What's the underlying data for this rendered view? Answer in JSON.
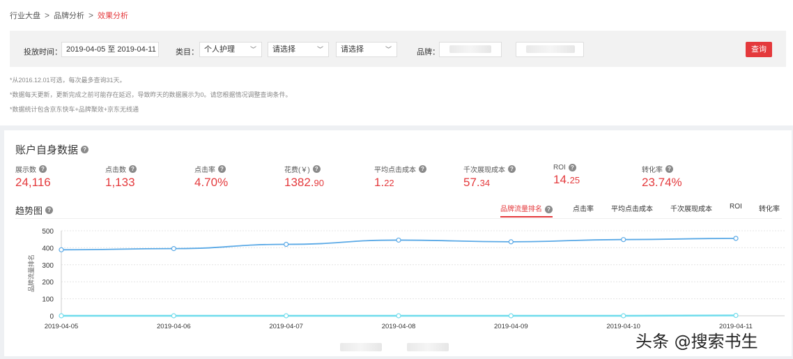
{
  "breadcrumb": {
    "item1": "行业大盘",
    "item2": "品牌分析",
    "item3": "效果分析",
    "sep": ">"
  },
  "filter": {
    "time_label": "投放时间：",
    "time_value": "2019-04-05 至 2019-04-11",
    "category_label": "类目：",
    "category_value": "个人护理",
    "select2": "请选择",
    "select3": "请选择",
    "brand_label": "品牌：",
    "query_label": "查询"
  },
  "notes": [
    "*从2016.12.01可选，每次最多查询31天。",
    "*数据每天更新，更新完成之前可能存在延迟，导致昨天的数据展示为0。请您根据情况调整查询条件。",
    "*数据统计包含京东快车+品牌聚效+京东无线通"
  ],
  "account": {
    "title": "账户自身数据",
    "metrics": [
      {
        "label": "展示数",
        "int": "24,116",
        "dec": ""
      },
      {
        "label": "点击数",
        "int": "1,133",
        "dec": ""
      },
      {
        "label": "点击率",
        "int": "4.70%",
        "dec": ""
      },
      {
        "label": "花费(￥)",
        "int": "1382.",
        "dec": "90"
      },
      {
        "label": "平均点击成本",
        "int": "1.",
        "dec": "22"
      },
      {
        "label": "千次展现成本",
        "int": "57.",
        "dec": "34"
      },
      {
        "label": "ROI",
        "int": "14.",
        "dec": "25"
      },
      {
        "label": "转化率",
        "int": "23.74%",
        "dec": ""
      }
    ]
  },
  "trend": {
    "title": "趋势图",
    "tabs": [
      "品牌流量排名",
      "点击率",
      "平均点击成本",
      "千次展现成本",
      "ROI",
      "转化率"
    ],
    "active_tab": 0
  },
  "chart_data": {
    "type": "line",
    "ylabel": "品牌流量排名",
    "ylim": [
      0,
      500
    ],
    "yticks": [
      0,
      100,
      200,
      300,
      400,
      500
    ],
    "x": [
      "2019-04-05",
      "2019-04-06",
      "2019-04-07",
      "2019-04-08",
      "2019-04-09",
      "2019-04-10",
      "2019-04-11"
    ],
    "series": [
      {
        "values": [
          388,
          395,
          420,
          445,
          435,
          448,
          455
        ],
        "color": "#5aa9e6"
      },
      {
        "values": [
          0,
          0,
          0,
          0,
          0,
          0,
          2
        ],
        "color": "#6fdcec"
      }
    ],
    "grid": true
  },
  "watermark": "头条 @搜索书生",
  "colors": {
    "accent": "#e4393c",
    "line1": "#5aa9e6",
    "line2": "#6fdcec"
  }
}
